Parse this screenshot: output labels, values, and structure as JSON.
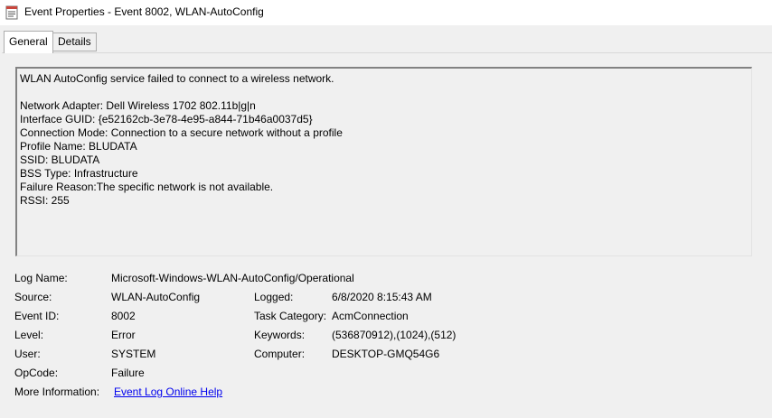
{
  "window": {
    "title": "Event Properties - Event 8002, WLAN-AutoConfig",
    "icon": "event-properties-icon"
  },
  "tabs": [
    {
      "label": "General",
      "active": true
    },
    {
      "label": "Details",
      "active": false
    }
  ],
  "description": {
    "summary": "WLAN AutoConfig service failed to connect to a wireless network.",
    "lines": [
      "Network Adapter: Dell Wireless 1702 802.11b|g|n",
      "Interface GUID: {e52162cb-3e78-4e95-a844-71b46a0037d5}",
      "Connection Mode: Connection to a secure network without a profile",
      "Profile Name: BLUDATA",
      "SSID: BLUDATA",
      "BSS Type: Infrastructure",
      "Failure Reason:The specific network is not available.",
      "RSSI: 255"
    ]
  },
  "details": {
    "log_name": {
      "label": "Log Name:",
      "value": "Microsoft-Windows-WLAN-AutoConfig/Operational"
    },
    "source": {
      "label": "Source:",
      "value": "WLAN-AutoConfig"
    },
    "logged": {
      "label": "Logged:",
      "value": "6/8/2020 8:15:43 AM"
    },
    "event_id": {
      "label": "Event ID:",
      "value": "8002"
    },
    "task_category": {
      "label": "Task Category:",
      "value": "AcmConnection"
    },
    "level": {
      "label": "Level:",
      "value": "Error"
    },
    "keywords": {
      "label": "Keywords:",
      "value": "(536870912),(1024),(512)"
    },
    "user": {
      "label": "User:",
      "value": "SYSTEM"
    },
    "computer": {
      "label": "Computer:",
      "value": "DESKTOP-GMQ54G6"
    },
    "opcode": {
      "label": "OpCode:",
      "value": "Failure"
    },
    "more_info": {
      "label": "More Information:",
      "link": "Event Log Online Help"
    }
  }
}
